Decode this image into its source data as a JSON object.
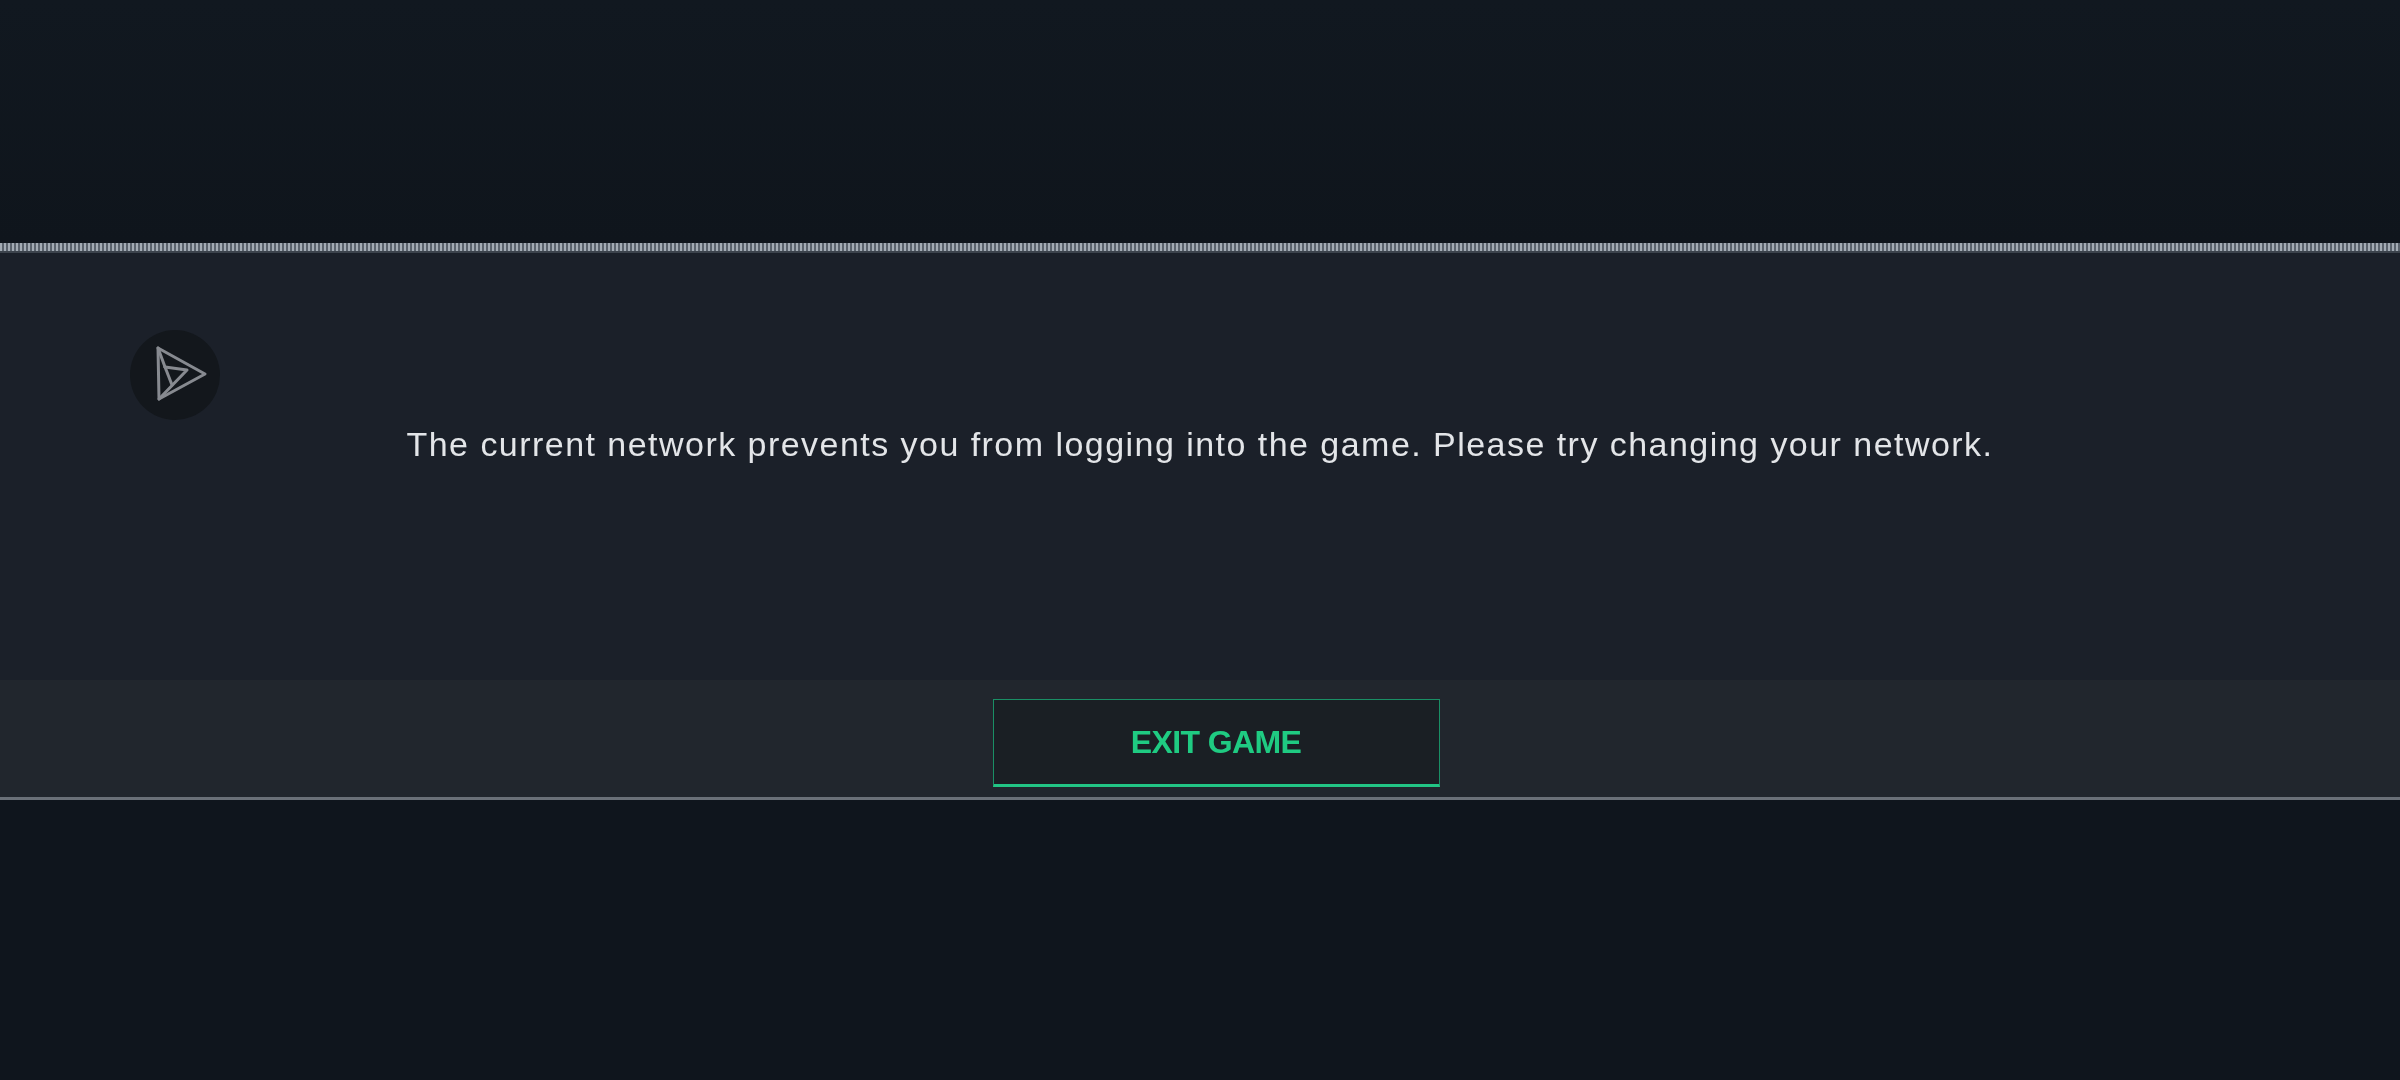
{
  "dialog": {
    "message": "The current network prevents you from logging into the game. Please try changing your network.",
    "button": {
      "label": "EXIT GAME"
    }
  }
}
